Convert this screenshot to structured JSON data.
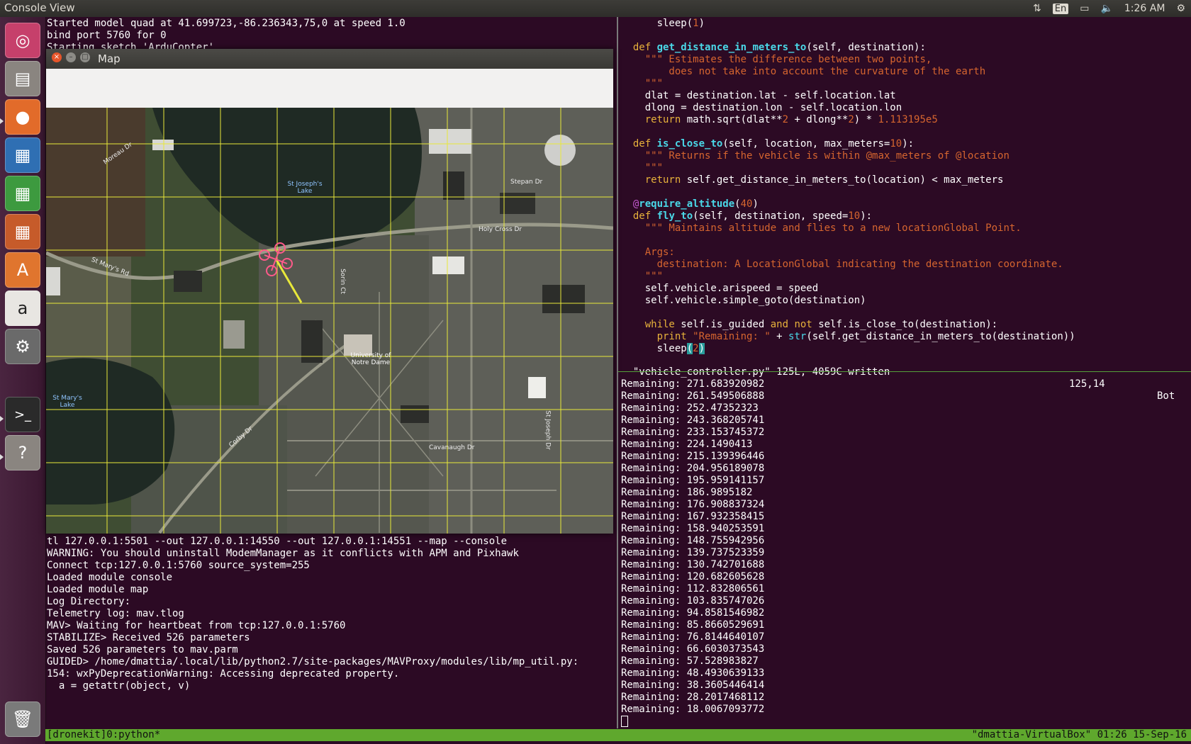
{
  "topbar": {
    "app_name": "Console",
    "menu_view": "View",
    "lang": "En",
    "time": "1:26 AM"
  },
  "launcher": {
    "items": [
      "ubuntu-dash",
      "files",
      "firefox",
      "writer",
      "calc",
      "impress",
      "software-center",
      "amazon",
      "system-settings",
      "terminal",
      "help",
      "trash"
    ]
  },
  "map_window": {
    "title": "Map",
    "labels": {
      "st_josephs_lake": "St Joseph's\nLake",
      "st_marys_lake": "St Mary's\nLake",
      "university": "University of\nNotre Dame",
      "holy_cross_dr": "Holy Cross Dr",
      "st_marys_rd": "St Mary's Rd",
      "stepan_dr": "Stepan Dr",
      "moreau_dr": "Moreau Dr",
      "corby_dr": "Corby Dr",
      "cavanaugh_dr": "Cavanaugh Dr",
      "sorin_ct": "Sorin Ct",
      "st_joseph_dr": "St Joseph Dr"
    }
  },
  "terminal_top_left": [
    "Started model quad at 41.699723,-86.236343,75,0 at speed 1.0",
    "bind port 5760 for 0",
    "Starting sketch 'ArduCopter'"
  ],
  "terminal_bottom_left": [
    "tl 127.0.0.1:5501 --out 127.0.0.1:14550 --out 127.0.0.1:14551 --map --console",
    "WARNING: You should uninstall ModemManager as it conflicts with APM and Pixhawk",
    "Connect tcp:127.0.0.1:5760 source_system=255",
    "Loaded module console",
    "Loaded module map",
    "Log Directory:",
    "Telemetry log: mav.tlog",
    "MAV> Waiting for heartbeat from tcp:127.0.0.1:5760",
    "STABILIZE> Received 526 parameters",
    "Saved 526 parameters to mav.parm",
    "GUIDED> /home/dmattia/.local/lib/python2.7/site-packages/MAVProxy/modules/lib/mp_util.py:",
    "154: wxPyDeprecationWarning: Accessing deprecated property.",
    "  a = getattr(object, v)"
  ],
  "code_lines": [
    [
      {
        "t": "      sleep("
      },
      {
        "t": "1",
        "c": "nm"
      },
      {
        "t": ")"
      }
    ],
    [
      {
        "t": ""
      }
    ],
    [
      {
        "t": "  "
      },
      {
        "t": "def",
        "c": "kw"
      },
      {
        "t": " "
      },
      {
        "t": "get_distance_in_meters_to",
        "c": "fn"
      },
      {
        "t": "(self, destination):"
      }
    ],
    [
      {
        "t": "    "
      },
      {
        "t": "\"\"\" Estimates the difference between two points,",
        "c": "st"
      }
    ],
    [
      {
        "t": "        does not take into account the curvature of the earth",
        "c": "st"
      }
    ],
    [
      {
        "t": "    \"\"\"",
        "c": "st"
      }
    ],
    [
      {
        "t": "    dlat = destination.lat - self.location.lat"
      }
    ],
    [
      {
        "t": "    dlong = destination.lon - self.location.lon"
      }
    ],
    [
      {
        "t": "    "
      },
      {
        "t": "return",
        "c": "kw"
      },
      {
        "t": " math.sqrt(dlat**"
      },
      {
        "t": "2",
        "c": "nm"
      },
      {
        "t": " + dlong**"
      },
      {
        "t": "2",
        "c": "nm"
      },
      {
        "t": ") * "
      },
      {
        "t": "1.113195e5",
        "c": "nm"
      }
    ],
    [
      {
        "t": ""
      }
    ],
    [
      {
        "t": "  "
      },
      {
        "t": "def",
        "c": "kw"
      },
      {
        "t": " "
      },
      {
        "t": "is_close_to",
        "c": "fn"
      },
      {
        "t": "(self, location, max_meters="
      },
      {
        "t": "10",
        "c": "nm"
      },
      {
        "t": "):"
      }
    ],
    [
      {
        "t": "    "
      },
      {
        "t": "\"\"\" Returns if the vehicle is within @max_meters of @location",
        "c": "st"
      }
    ],
    [
      {
        "t": "    \"\"\"",
        "c": "st"
      }
    ],
    [
      {
        "t": "    "
      },
      {
        "t": "return",
        "c": "kw"
      },
      {
        "t": " self.get_distance_in_meters_to(location) < max_meters"
      }
    ],
    [
      {
        "t": ""
      }
    ],
    [
      {
        "t": "  "
      },
      {
        "t": "@",
        "c": "dec"
      },
      {
        "t": "require_altitude",
        "c": "fn"
      },
      {
        "t": "("
      },
      {
        "t": "40",
        "c": "nm"
      },
      {
        "t": ")"
      }
    ],
    [
      {
        "t": "  "
      },
      {
        "t": "def",
        "c": "kw"
      },
      {
        "t": " "
      },
      {
        "t": "fly_to",
        "c": "fn"
      },
      {
        "t": "(self, destination, speed="
      },
      {
        "t": "10",
        "c": "nm"
      },
      {
        "t": "):"
      }
    ],
    [
      {
        "t": "    "
      },
      {
        "t": "\"\"\" Maintains altitude and flies to a new locationGlobal Point.",
        "c": "st"
      }
    ],
    [
      {
        "t": ""
      }
    ],
    [
      {
        "t": "    Args:",
        "c": "st"
      }
    ],
    [
      {
        "t": "      destination: A LocationGlobal indicating the destination coordinate.",
        "c": "st"
      }
    ],
    [
      {
        "t": "    \"\"\"",
        "c": "st"
      }
    ],
    [
      {
        "t": "    self.vehicle.arispeed = speed"
      }
    ],
    [
      {
        "t": "    self.vehicle.simple_goto(destination)"
      }
    ],
    [
      {
        "t": ""
      }
    ],
    [
      {
        "t": "    "
      },
      {
        "t": "while",
        "c": "kw"
      },
      {
        "t": " self.is_guided "
      },
      {
        "t": "and",
        "c": "kw"
      },
      {
        "t": " "
      },
      {
        "t": "not",
        "c": "kw"
      },
      {
        "t": " self.is_close_to(destination):"
      }
    ],
    [
      {
        "t": "      "
      },
      {
        "t": "print",
        "c": "kw"
      },
      {
        "t": " "
      },
      {
        "t": "\"Remaining: \"",
        "c": "st"
      },
      {
        "t": " + "
      },
      {
        "t": "str",
        "c": "bi"
      },
      {
        "t": "(self.get_distance_in_meters_to(destination))"
      }
    ],
    [
      {
        "t": "      sleep"
      },
      {
        "t": "(",
        "c": "br"
      },
      {
        "t": "2",
        "c": "nm"
      },
      {
        "t": ")",
        "c": "br"
      }
    ]
  ],
  "vim_status": {
    "file_msg": "\"vehicle_controller.py\" 125L, 4059C written",
    "position": "125,14",
    "scroll": "Bot"
  },
  "remaining_prefix": "Remaining: ",
  "remaining_values": [
    "271.683920982",
    "261.549506888",
    "252.47352323",
    "243.368205741",
    "233.153745372",
    "224.1490413",
    "215.139396446",
    "204.956189078",
    "195.959141157",
    "186.9895182",
    "176.908837324",
    "167.932358415",
    "158.940253591",
    "148.755942956",
    "139.737523359",
    "130.742701688",
    "120.682605628",
    "112.832806561",
    "103.835747026",
    "94.8581546982",
    "85.8660529691",
    "76.8144640107",
    "66.6030373543",
    "57.528983827",
    "48.4930639133",
    "38.3605446414",
    "28.2017468112",
    "18.0067093772"
  ],
  "tmux": {
    "left": "[dronekit]0:python*",
    "right": "\"dmattia-VirtualBox\" 01:26 15-Sep-16"
  },
  "colors": {
    "terminal_bg": "#2c0a24",
    "tmux_bar": "#5fa82d",
    "grid": "#e8e83a",
    "drone": "#ff5a8a"
  }
}
